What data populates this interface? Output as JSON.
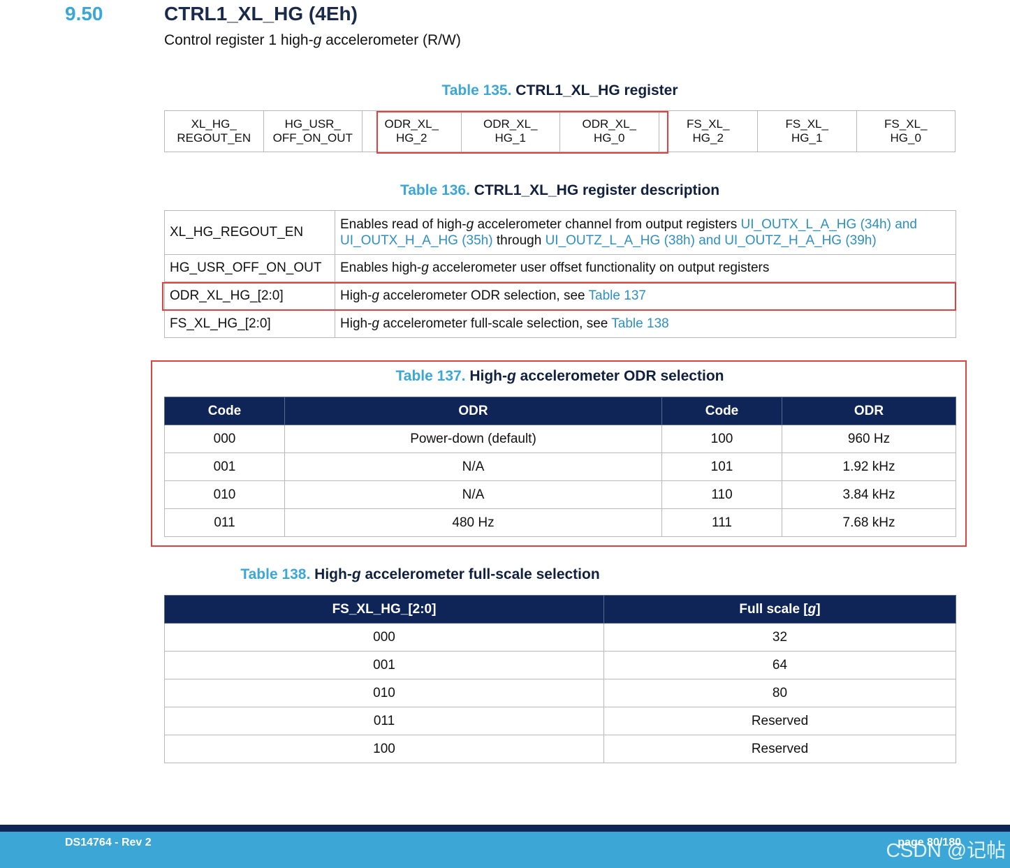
{
  "section": {
    "number": "9.50",
    "title": "CTRL1_XL_HG (4Eh)",
    "subtitle_pre": "Control register 1 high-",
    "subtitle_g": "g",
    "subtitle_post": " accelerometer (R/W)"
  },
  "table135": {
    "num": "Table 135.",
    "title": "CTRL1_XL_HG register",
    "cells": [
      [
        "XL_HG_",
        "REGOUT_EN"
      ],
      [
        "HG_USR_",
        "OFF_ON_OUT"
      ],
      [
        "ODR_XL_",
        "HG_2"
      ],
      [
        "ODR_XL_",
        "HG_1"
      ],
      [
        "ODR_XL_",
        "HG_0"
      ],
      [
        "FS_XL_",
        "HG_2"
      ],
      [
        "FS_XL_",
        "HG_1"
      ],
      [
        "FS_XL_",
        "HG_0"
      ]
    ]
  },
  "table136": {
    "num": "Table 136.",
    "title": "CTRL1_XL_HG register description",
    "rows": [
      {
        "name": "XL_HG_REGOUT_EN",
        "d1": "Enables read of high-",
        "g": "g",
        "d2": " accelerometer channel from output registers ",
        "l1": "UI_OUTX_L_A_HG (34h) and UI_OUTX_H_A_HG (35h)",
        "d3": " through ",
        "l2": "UI_OUTZ_L_A_HG (38h) and UI_OUTZ_H_A_HG (39h)"
      },
      {
        "name": "HG_USR_OFF_ON_OUT",
        "d1": "Enables high-",
        "g": "g",
        "d2": " accelerometer user offset functionality on output registers"
      },
      {
        "name": "ODR_XL_HG_[2:0]",
        "d1": "High-",
        "g": "g",
        "d2": " accelerometer ODR selection, see ",
        "l1": "Table 137"
      },
      {
        "name": "FS_XL_HG_[2:0]",
        "d1": "High-",
        "g": "g",
        "d2": " accelerometer full-scale selection, see ",
        "l1": "Table 138"
      }
    ]
  },
  "table137": {
    "num": "Table 137.",
    "title_pre": "High-",
    "title_g": "g",
    "title_post": " accelerometer ODR selection",
    "headers": [
      "Code",
      "ODR",
      "Code",
      "ODR"
    ],
    "rows": [
      [
        "000",
        "Power-down (default)",
        "100",
        "960 Hz"
      ],
      [
        "001",
        "N/A",
        "101",
        "1.92 kHz"
      ],
      [
        "010",
        "N/A",
        "110",
        "3.84 kHz"
      ],
      [
        "011",
        "480 Hz",
        "111",
        "7.68 kHz"
      ]
    ]
  },
  "table138": {
    "num": "Table 138.",
    "title_pre": "High-",
    "title_g": "g",
    "title_post": " accelerometer full-scale selection",
    "header1": "FS_XL_HG_[2:0]",
    "header2_pre": "Full scale [",
    "header2_g": "g",
    "header2_post": "]",
    "rows": [
      [
        "000",
        "32"
      ],
      [
        "001",
        "64"
      ],
      [
        "010",
        "80"
      ],
      [
        "011",
        "Reserved"
      ],
      [
        "100",
        "Reserved"
      ]
    ]
  },
  "footer": {
    "doc": "DS14764 - Rev 2",
    "page": "page 80/180",
    "watermark": "CSDN @记帖"
  },
  "colors": {
    "accent": "#3ca7d6",
    "header_bg": "#0f2557",
    "highlight": "#e0403e"
  }
}
